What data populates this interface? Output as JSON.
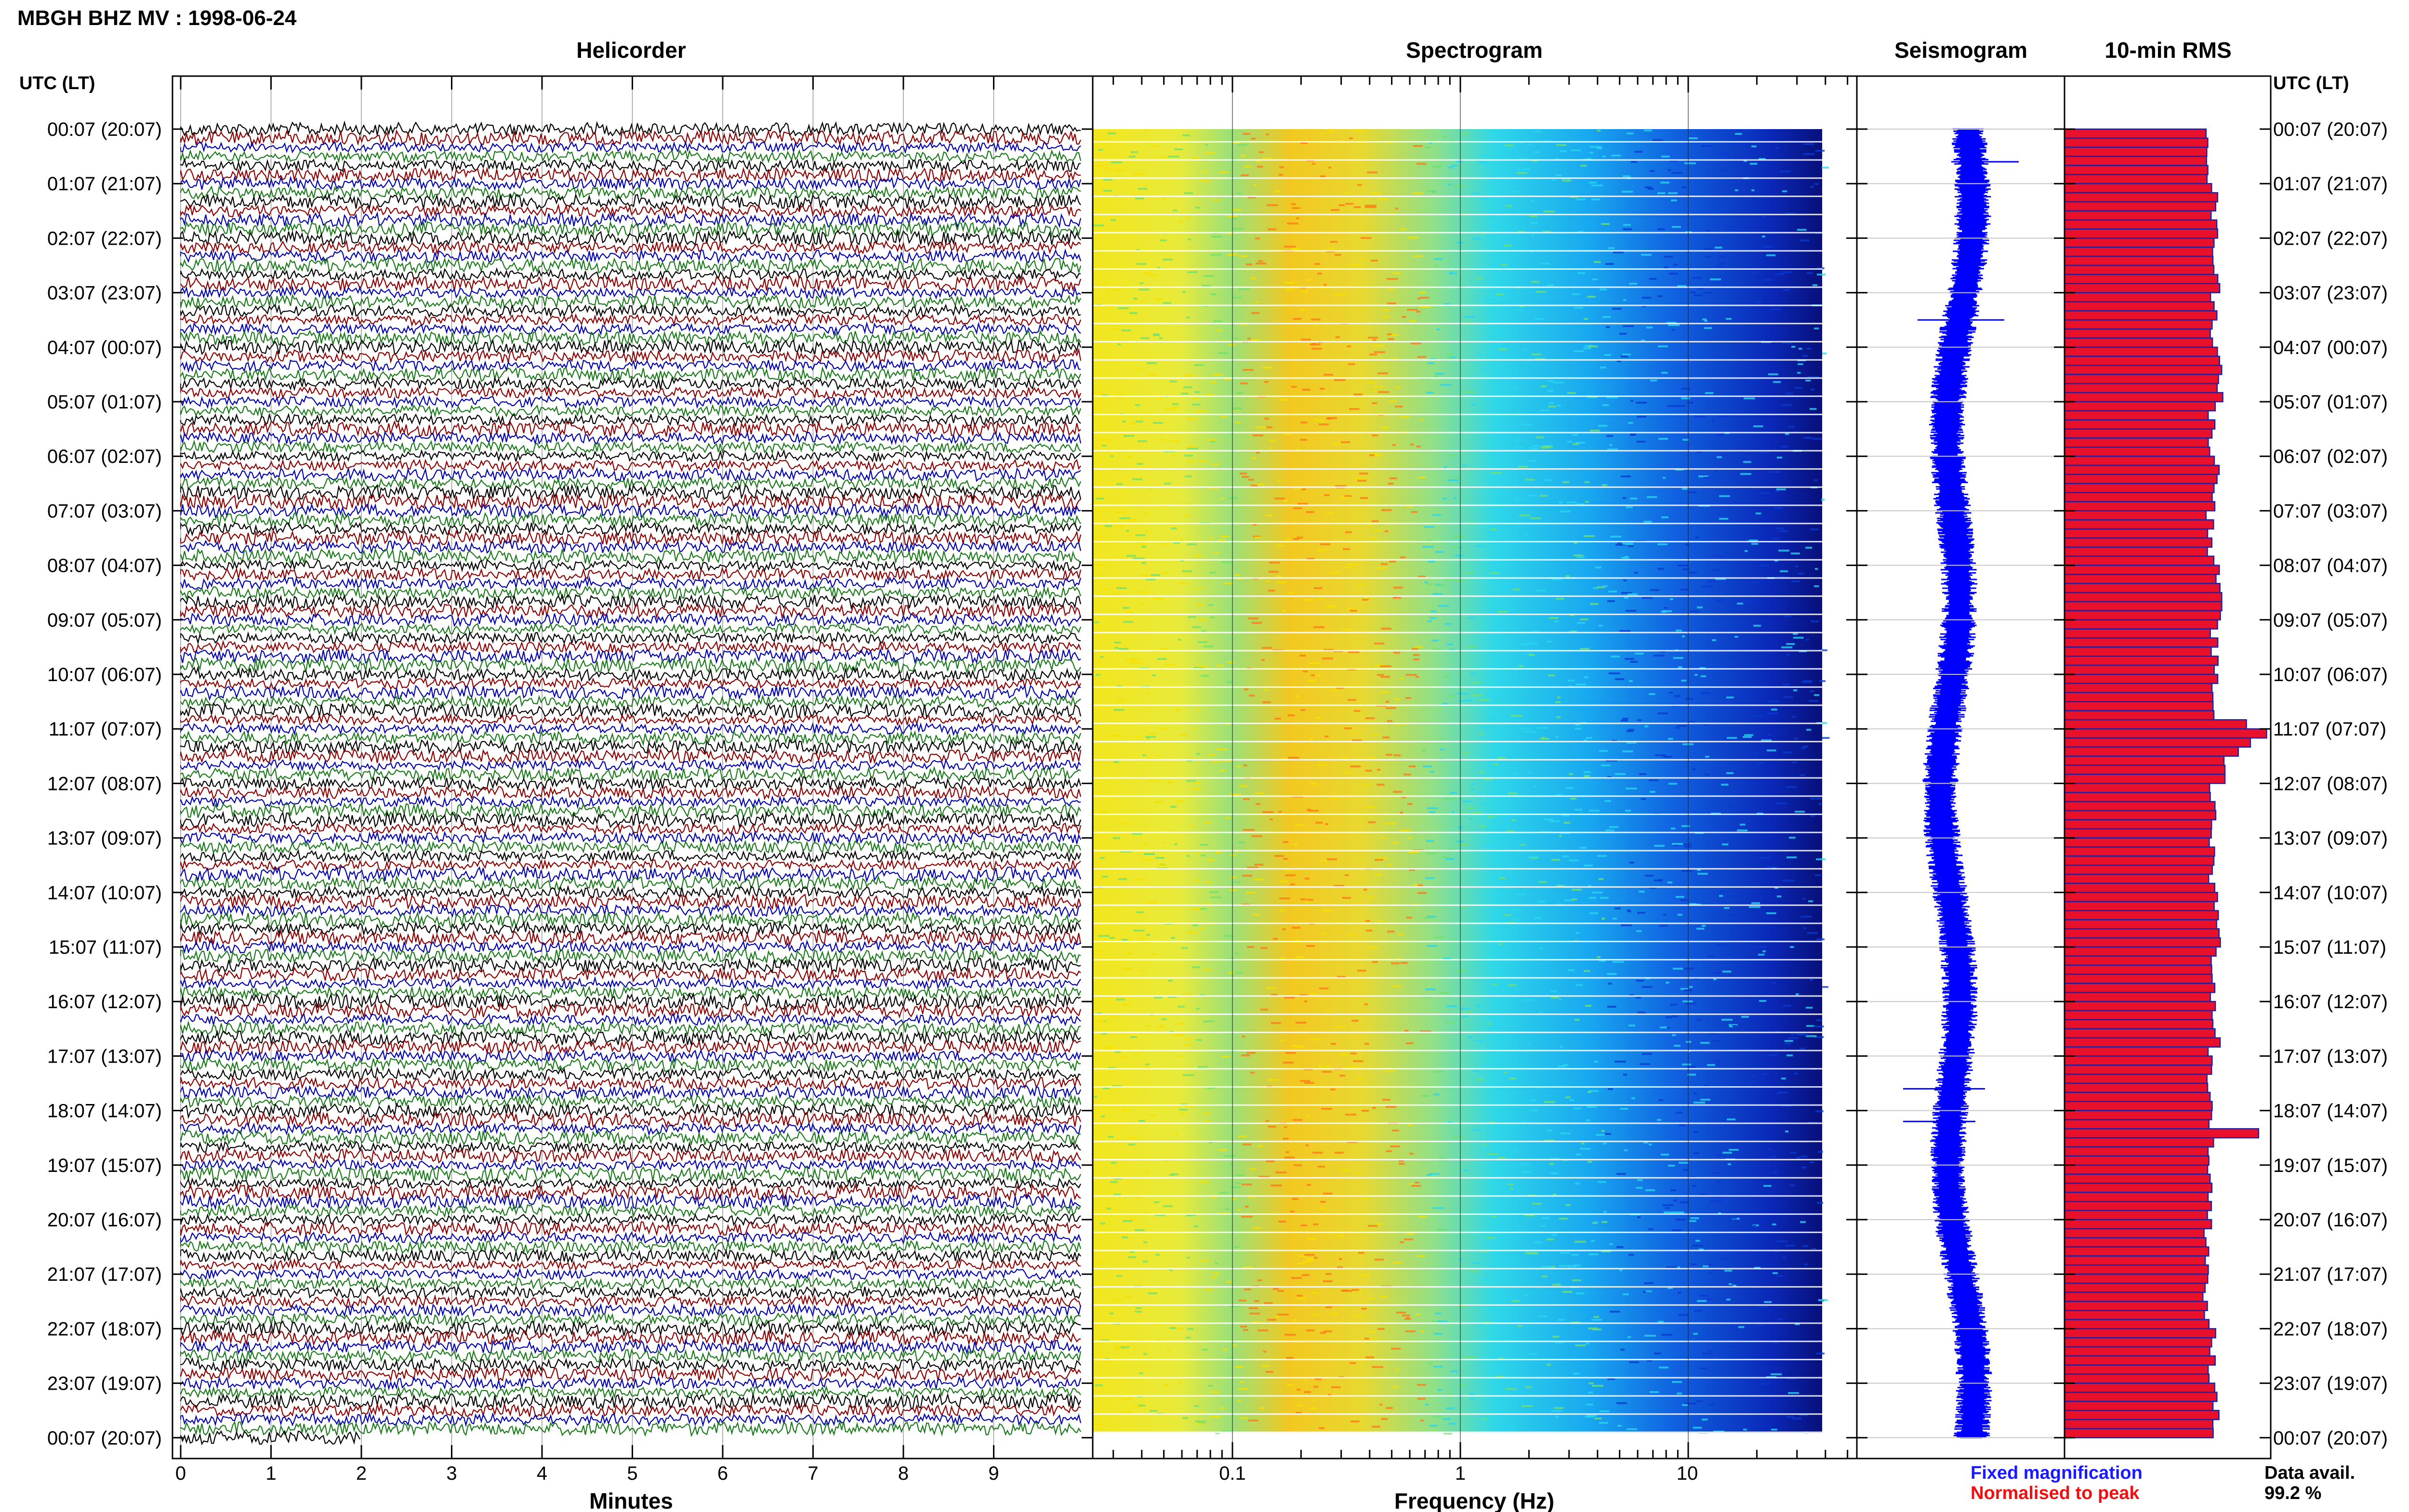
{
  "header": {
    "station_title": "MBGH BHZ MV : 1998-06-24",
    "utc_lt_left": "UTC (LT)",
    "utc_lt_right": "UTC (LT)"
  },
  "panels": {
    "helicorder": "Helicorder",
    "spectrogram": "Spectrogram",
    "seismogram": "Seismogram",
    "rms": "10-min RMS"
  },
  "row_labels": [
    "00:07 (20:07)",
    "01:07 (21:07)",
    "02:07 (22:07)",
    "03:07 (23:07)",
    "04:07 (00:07)",
    "05:07 (01:07)",
    "06:07 (02:07)",
    "07:07 (03:07)",
    "08:07 (04:07)",
    "09:07 (05:07)",
    "10:07 (06:07)",
    "11:07 (07:07)",
    "12:07 (08:07)",
    "13:07 (09:07)",
    "14:07 (10:07)",
    "15:07 (11:07)",
    "16:07 (12:07)",
    "17:07 (13:07)",
    "18:07 (14:07)",
    "19:07 (15:07)",
    "20:07 (16:07)",
    "21:07 (17:07)",
    "22:07 (18:07)",
    "23:07 (19:07)",
    "00:07 (20:07)"
  ],
  "legend": {
    "fixed_magnification": "Fixed magnification",
    "normalised_to_peak": "Normalised to peak",
    "fixed_color": "#1a1aff",
    "normalised_color": "#ee1111"
  },
  "data_availability": {
    "label": "Data avail.",
    "value": "99.2 %"
  },
  "colors": {
    "trace_cycle": [
      "#000000",
      "#8b0000",
      "#0000aa",
      "#1a7a1a"
    ],
    "seismogram": "#0000ff",
    "rms_fill": "#e8102a",
    "rms_edge": "#2020a0"
  },
  "chart_data": [
    {
      "type": "line",
      "title": "Helicorder",
      "xlabel": "Minutes",
      "x_ticks": [
        "0",
        "1",
        "2",
        "3",
        "4",
        "5",
        "6",
        "7",
        "8",
        "9"
      ],
      "xlim": [
        0,
        10
      ],
      "rows_per_hour": 6,
      "traces": 145,
      "last_trace_minutes": 2
    },
    {
      "type": "heatmap",
      "title": "Spectrogram",
      "xlabel": "Frequency (Hz)",
      "x_scale": "log",
      "x_ticks": [
        "0.1",
        "1",
        "10"
      ],
      "xlim": [
        0.02,
        40
      ],
      "colormap": "jet"
    },
    {
      "type": "line",
      "title": "Seismogram"
    },
    {
      "type": "bar",
      "title": "10-min RMS",
      "orientation": "horizontal",
      "bins": 144,
      "hourly_baseline": [
        0.72,
        0.74,
        0.75,
        0.74,
        0.77,
        0.73,
        0.75,
        0.72,
        0.76,
        0.74,
        0.74,
        0.8,
        0.73,
        0.73,
        0.76,
        0.74,
        0.73,
        0.72,
        0.72,
        0.72,
        0.71,
        0.7,
        0.73,
        0.75
      ],
      "peak_bins": [
        {
          "bin": 66,
          "value": 1.0
        },
        {
          "bin": 65,
          "value": 0.9
        },
        {
          "bin": 67,
          "value": 0.92
        },
        {
          "bin": 68,
          "value": 0.86
        },
        {
          "bin": 110,
          "value": 0.96
        },
        {
          "bin": 100,
          "value": 0.77
        }
      ]
    }
  ]
}
